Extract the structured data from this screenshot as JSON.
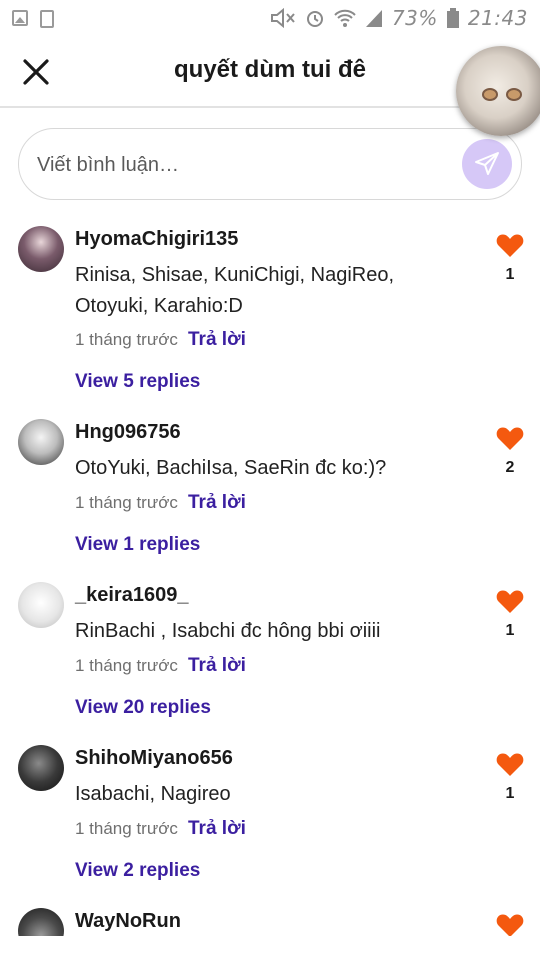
{
  "status_bar": {
    "battery": "73%",
    "time": "21:43"
  },
  "header": {
    "title": "quyết dùm tui đê"
  },
  "comment_input": {
    "placeholder": "Viết bình luận…"
  },
  "comments": [
    {
      "username": "HyomaChigiri135",
      "text": "Rinisa, Shisae, KuniChigi, NagiReo, Otoyuki, Karahio:D",
      "time": "1 tháng trước",
      "reply_label": "Trả lời",
      "view_replies": "View 5 replies",
      "likes": "1"
    },
    {
      "username": "Hng096756",
      "text": "OtoYuki, BachiIsa, SaeRin đc ko:)?",
      "time": "1 tháng trước",
      "reply_label": "Trả lời",
      "view_replies": "View 1 replies",
      "likes": "2"
    },
    {
      "username": "_keira1609_",
      "text": "RinBachi , Isabchi đc hông bbi ơiiii",
      "time": "1 tháng trước",
      "reply_label": "Trả lời",
      "view_replies": "View 20 replies",
      "likes": "1"
    },
    {
      "username": "ShihoMiyano656",
      "text": "Isabachi, Nagireo",
      "time": "1 tháng trước",
      "reply_label": "Trả lời",
      "view_replies": "View 2 replies",
      "likes": "1"
    },
    {
      "username": "WayNoRun"
    }
  ],
  "colors": {
    "accent": "#3b1fa0",
    "heart": "#f4590f",
    "send_button": "#d6c8f7"
  }
}
